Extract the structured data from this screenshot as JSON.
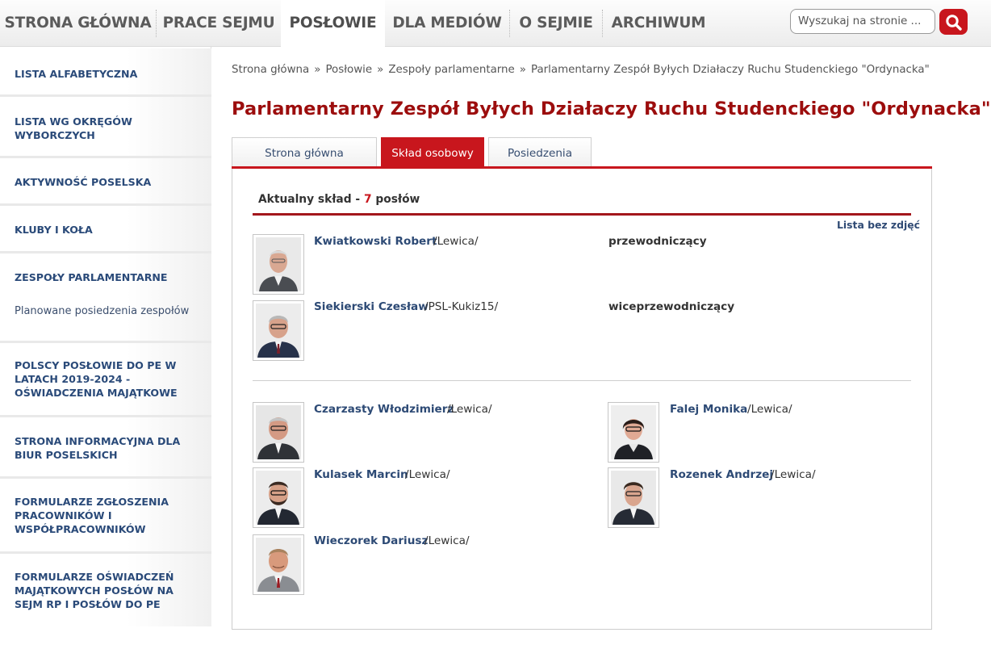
{
  "topnav": {
    "items": [
      "STRONA GŁÓWNA",
      "PRACE SEJMU",
      "POSŁOWIE",
      "DLA MEDIÓW",
      "O SEJMIE",
      "ARCHIWUM"
    ],
    "active_index": 2,
    "search_placeholder": "Wyszukaj na stronie ...",
    "search_icon": "magnifier-icon"
  },
  "sidebar": {
    "items": [
      "LISTA ALFABETYCZNA",
      "LISTA WG OKRĘGÓW WYBORCZYCH",
      "AKTYWNOŚĆ POSELSKA",
      "KLUBY I KOŁA",
      "ZESPOŁY PARLAMENTARNE",
      "POLSCY POSŁOWIE DO PE W LATACH 2019-2024 - OŚWIADCZENIA MAJĄTKOWE",
      "STRONA INFORMACYJNA DLA BIUR POSELSKICH",
      "FORMULARZE ZGŁOSZENIA PRACOWNIKÓW I WSPÓŁPRACOWNIKÓW",
      "FORMULARZE OŚWIADCZEŃ MAJĄTKOWYCH POSŁÓW NA SEJM RP I POSŁÓW DO PE"
    ],
    "subitem": "Planowane posiedzenia zespołów"
  },
  "breadcrumb": [
    "Strona główna",
    "Posłowie",
    "Zespoły parlamentarne",
    "Parlamentarny Zespół Byłych Działaczy Ruchu Studenckiego \"Ordynacka\""
  ],
  "breadcrumb_separator": "»",
  "page_title": "Parlamentarny Zespół Byłych Działaczy Ruchu Studenckiego \"Ordynacka\"",
  "tabs": [
    "Strona główna",
    "Skład osobowy",
    "Posiedzenia"
  ],
  "active_tab": 1,
  "composition": {
    "label_prefix": "Aktualny skład - ",
    "count": "7",
    "label_suffix": " posłów",
    "no_photos_link": "Lista bez zdjęć"
  },
  "leaders": [
    {
      "name": "Kwiatkowski Robert",
      "club": "/Lewica/",
      "role": "przewodniczący"
    },
    {
      "name": "Siekierski Czesław",
      "club": "/PSL-Kukiz15/",
      "role": "wiceprzewodniczący"
    }
  ],
  "members": [
    {
      "name": "Czarzasty Włodzimierz",
      "club": "/Lewica/"
    },
    {
      "name": "Falej Monika",
      "club": "/Lewica/"
    },
    {
      "name": "Kulasek Marcin",
      "club": "/Lewica/"
    },
    {
      "name": "Rozenek Andrzej",
      "club": "/Lewica/"
    },
    {
      "name": "Wieczorek Dariusz",
      "club": "/Lewica/"
    }
  ],
  "colors": {
    "accent_red": "#c8161d",
    "title_red": "#9c0d0d",
    "link_blue": "#2d4a75"
  }
}
